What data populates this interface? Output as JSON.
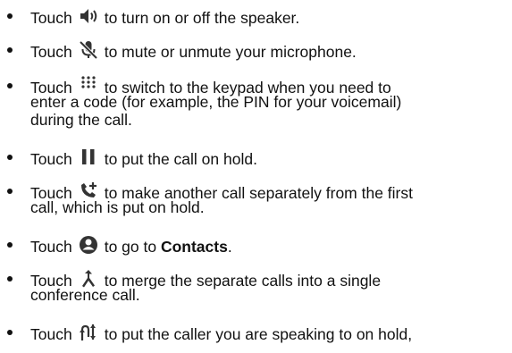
{
  "items": [
    {
      "prefix": "Touch",
      "icon": "speaker-icon",
      "lines": [
        "to turn on or off the speaker."
      ]
    },
    {
      "prefix": "Touch",
      "icon": "mute-microphone-icon",
      "lines": [
        "to mute or unmute your microphone."
      ]
    },
    {
      "prefix": "Touch",
      "icon": "keypad-icon",
      "lines": [
        "to switch to the keypad when you need to",
        "enter a code (for example, the PIN for your voicemail)",
        "during the call."
      ]
    },
    {
      "prefix": "Touch",
      "icon": "pause-icon",
      "lines": [
        "to put the call on hold."
      ]
    },
    {
      "prefix": "Touch",
      "icon": "add-call-icon",
      "lines": [
        "to make another call separately from the first",
        "call, which is put on hold."
      ]
    },
    {
      "prefix": "Touch",
      "icon": "contacts-icon",
      "lines_before_bold": "to go to ",
      "bold": "Contacts",
      "after_bold": "."
    },
    {
      "prefix": "Touch",
      "icon": "merge-calls-icon",
      "lines": [
        "to merge the separate calls into a single",
        "conference call."
      ]
    },
    {
      "prefix": "Touch",
      "icon": "swap-calls-icon",
      "lines": [
        "to put the caller you are speaking to on hold,"
      ]
    }
  ]
}
